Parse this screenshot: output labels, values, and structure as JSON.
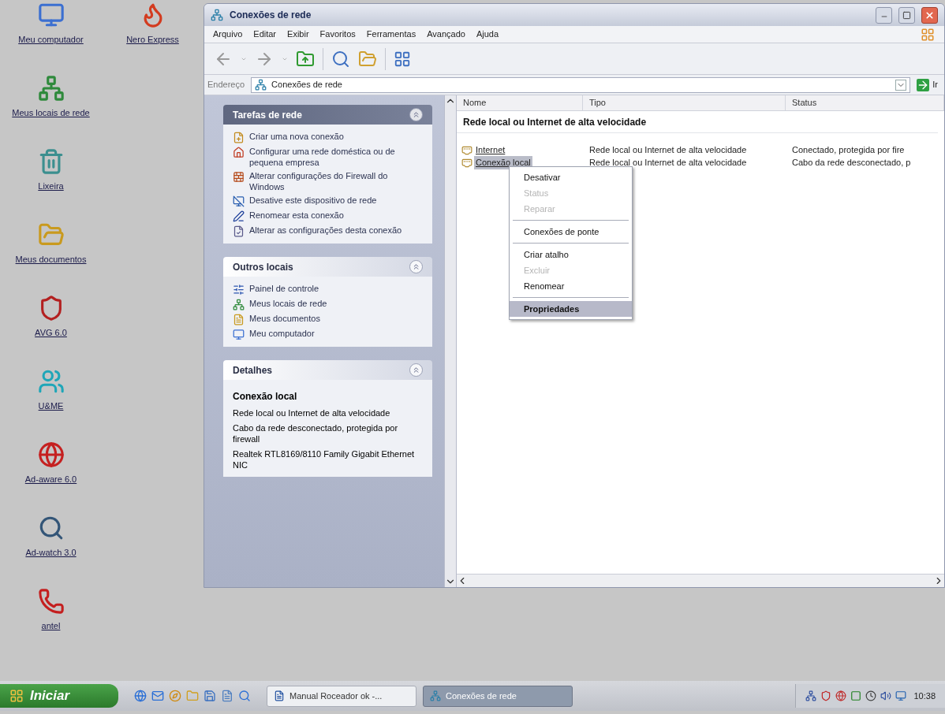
{
  "desktop_icons": [
    {
      "label": "Meu computador"
    },
    {
      "label": "Nero Express"
    },
    {
      "label": "Meus locais de rede"
    },
    {
      "label": "Lixeira"
    },
    {
      "label": "Meus documentos"
    },
    {
      "label": "AVG 6.0"
    },
    {
      "label": "U&ME"
    },
    {
      "label": "Ad-aware 6.0"
    },
    {
      "label": "Ad-watch 3.0"
    },
    {
      "label": "antel"
    }
  ],
  "window": {
    "title": "Conexões de rede",
    "menu": [
      "Arquivo",
      "Editar",
      "Exibir",
      "Favoritos",
      "Ferramentas",
      "Avançado",
      "Ajuda"
    ],
    "address": {
      "label": "Endereço",
      "value": "Conexões de rede",
      "go": "Ir"
    }
  },
  "task_panes": [
    {
      "title": "Tarefas de rede",
      "kind": "tasks",
      "items": [
        "Criar uma nova conexão",
        "Configurar uma rede doméstica ou de pequena empresa",
        "Alterar configurações do Firewall do Windows",
        "Desative este dispositivo de rede",
        "Renomear esta conexão",
        "Alterar as configurações desta conexão"
      ]
    },
    {
      "title": "Outros locais",
      "kind": "places",
      "items": [
        "Painel de controle",
        "Meus locais de rede",
        "Meus documentos",
        "Meu computador"
      ]
    },
    {
      "title": "Detalhes",
      "kind": "details",
      "name": "Conexão local",
      "lines": [
        "Rede local ou Internet de alta velocidade",
        "Cabo da rede desconectado, protegida por firewall",
        "Realtek RTL8169/8110 Family Gigabit Ethernet NIC"
      ]
    }
  ],
  "list": {
    "columns": [
      "Nome",
      "Tipo",
      "Status"
    ],
    "group": "Rede local ou Internet de alta velocidade",
    "rows": [
      {
        "name": "Internet",
        "type": "Rede local ou Internet de alta velocidade",
        "status": "Conectado, protegida por fire",
        "selected": false
      },
      {
        "name": "Conexão local",
        "type": "Rede local ou Internet de alta velocidade",
        "status": "Cabo da rede desconectado, p",
        "selected": true
      }
    ]
  },
  "context_menu": [
    {
      "kind": "item",
      "label": "Desativar",
      "disabled": false,
      "default": false,
      "selected": false
    },
    {
      "kind": "item",
      "label": "Status",
      "disabled": true,
      "default": false,
      "selected": false
    },
    {
      "kind": "item",
      "label": "Reparar",
      "disabled": true,
      "default": false,
      "selected": false
    },
    {
      "kind": "separator"
    },
    {
      "kind": "item",
      "label": "Conexões de ponte",
      "disabled": false,
      "default": false,
      "selected": false
    },
    {
      "kind": "separator"
    },
    {
      "kind": "item",
      "label": "Criar atalho",
      "disabled": false,
      "default": false,
      "selected": false
    },
    {
      "kind": "item",
      "label": "Excluir",
      "disabled": true,
      "default": false,
      "selected": false
    },
    {
      "kind": "item",
      "label": "Renomear",
      "disabled": false,
      "default": false,
      "selected": false
    },
    {
      "kind": "separator"
    },
    {
      "kind": "item",
      "label": "Propriedades",
      "disabled": false,
      "default": true,
      "selected": true
    }
  ],
  "taskbar": {
    "start": "Iniciar",
    "tasks": [
      {
        "label": "Manual Roceador ok -...",
        "selected": false
      },
      {
        "label": "Conexões de rede",
        "selected": true
      }
    ],
    "clock": "10:38"
  }
}
